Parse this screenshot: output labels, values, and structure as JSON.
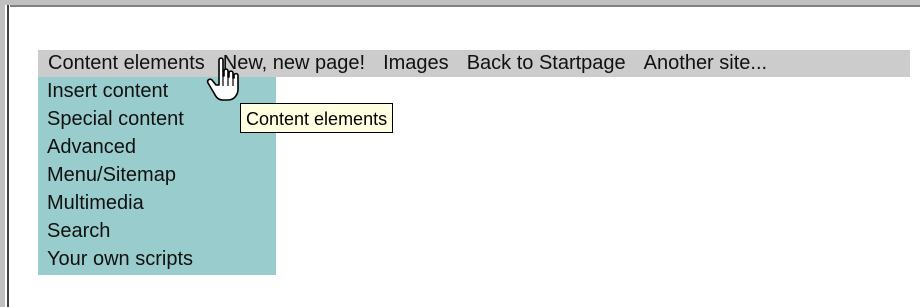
{
  "menubar": {
    "items": [
      {
        "label": "Content elements"
      },
      {
        "label": "New, new page!"
      },
      {
        "label": "Images"
      },
      {
        "label": "Back to Startpage"
      },
      {
        "label": "Another site..."
      }
    ]
  },
  "submenu": {
    "items": [
      {
        "label": "Insert content"
      },
      {
        "label": "Special content"
      },
      {
        "label": "Advanced"
      },
      {
        "label": "Menu/Sitemap"
      },
      {
        "label": "Multimedia"
      },
      {
        "label": "Search"
      },
      {
        "label": "Your own scripts"
      }
    ]
  },
  "tooltip": {
    "text": "Content elements"
  },
  "colors": {
    "menubar_bg": "#cccccc",
    "submenu_bg": "#99cccc",
    "tooltip_bg": "#ffffe1"
  },
  "cursor": {
    "icon": "hand-pointer-icon"
  }
}
